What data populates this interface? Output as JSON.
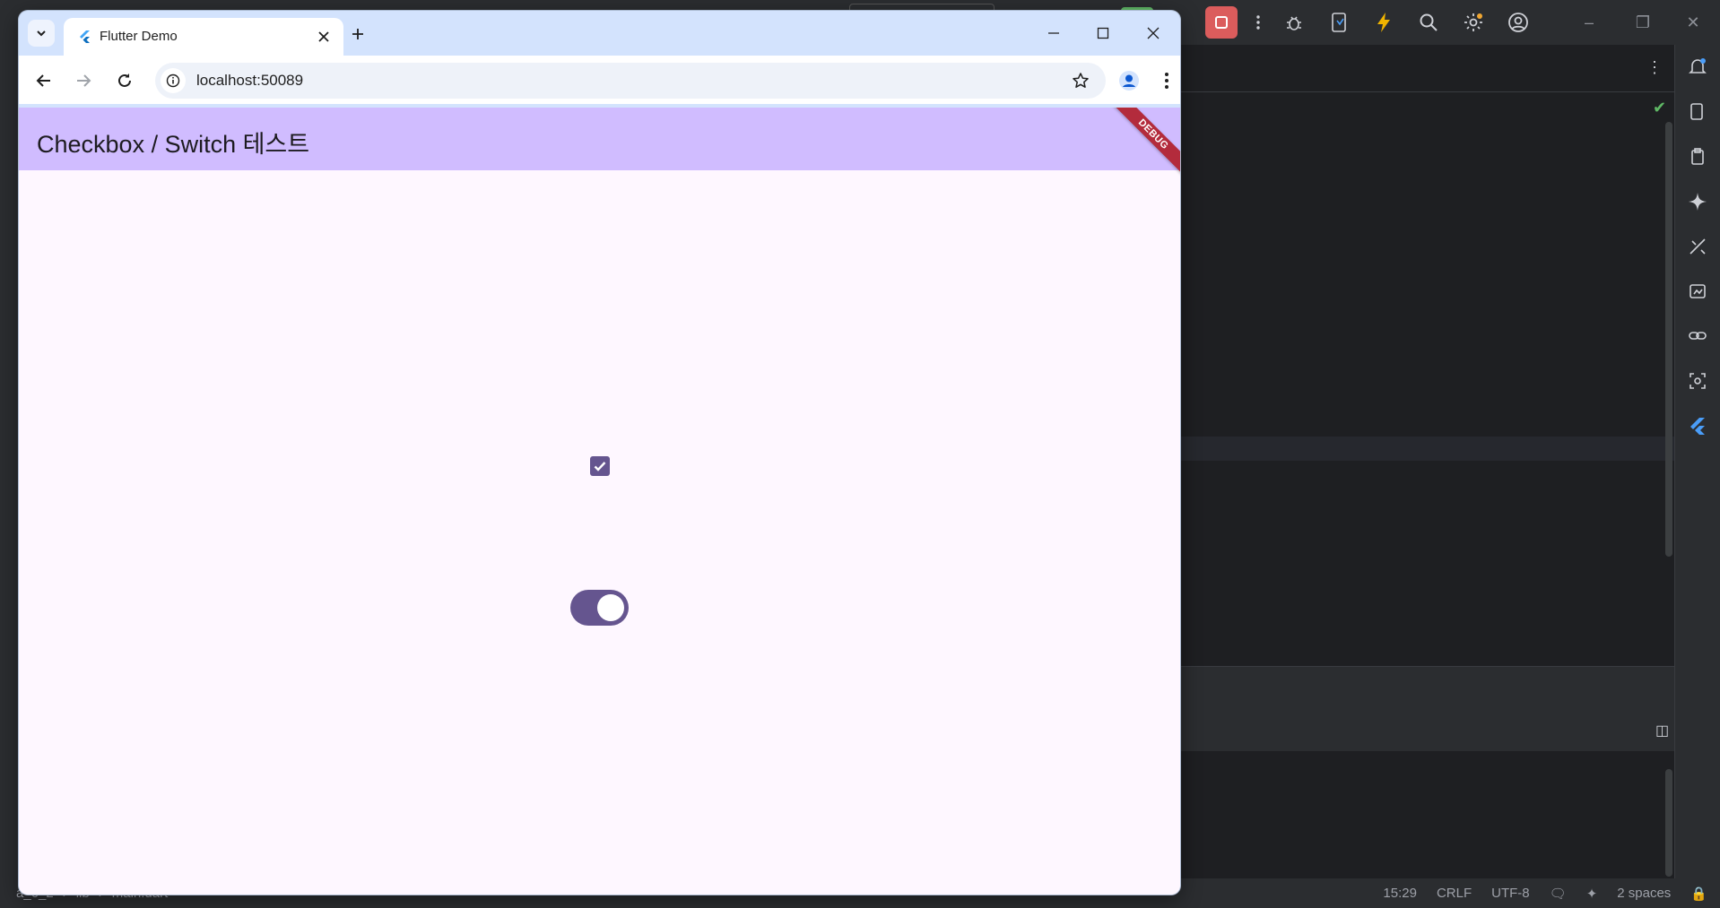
{
  "browser": {
    "tab_title": "Flutter Demo",
    "url": "localhost:50089"
  },
  "app": {
    "title": "Checkbox / Switch 테스트",
    "debug_banner": "DEBUG",
    "checkbox_checked": true,
    "switch_on": true,
    "accent_color": "#65558f",
    "appbar_color": "#d0bcff",
    "background_color": "#fef7ff"
  },
  "ide": {
    "statusbar": {
      "breadcrumb": [
        "a_6_2",
        "lib",
        "main.dart"
      ],
      "position": "15:29",
      "line_ending": "CRLF",
      "encoding": "UTF-8",
      "indent": "2 spaces"
    }
  }
}
